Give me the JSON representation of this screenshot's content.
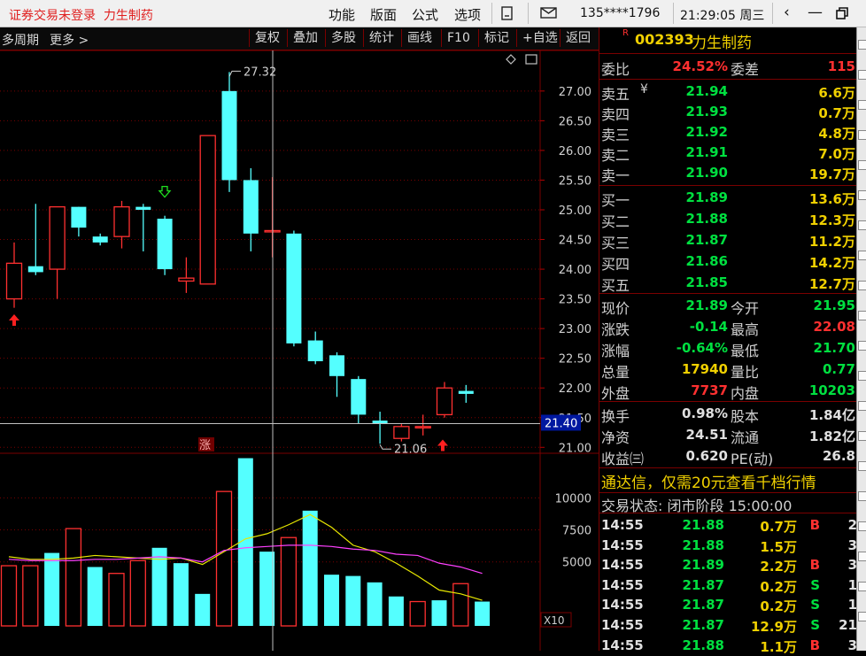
{
  "titlebar": {
    "status": "证券交易未登录",
    "stock_name": "力生制药",
    "menu": [
      "功能",
      "版面",
      "公式",
      "选项"
    ],
    "phone": "135****1796",
    "clock": "21:29:05 周三"
  },
  "toolbar": {
    "left": [
      "多周期",
      "更多 >"
    ],
    "buttons": [
      "复权",
      "叠加",
      "多股",
      "统计",
      "画线",
      "F10",
      "标记",
      "+自选",
      "返回"
    ]
  },
  "chart_data": {
    "type": "candlestick",
    "price_axis": {
      "ticks": [
        "27.00",
        "26.50",
        "26.00",
        "25.50",
        "25.00",
        "24.50",
        "24.00",
        "23.50",
        "23.00",
        "22.50",
        "22.00",
        "21.50",
        "21.00"
      ],
      "range": [
        20.9,
        27.4
      ]
    },
    "high_label": "27.32",
    "low_label": "21.06",
    "crosshair_price": "21.40",
    "zhang_label": "涨",
    "candles": [
      {
        "o": 23.5,
        "h": 24.45,
        "l": 23.35,
        "c": 24.1
      },
      {
        "o": 24.05,
        "h": 25.1,
        "l": 23.9,
        "c": 23.95
      },
      {
        "o": 24.0,
        "h": 25.05,
        "l": 23.5,
        "c": 25.05
      },
      {
        "o": 25.05,
        "h": 25.05,
        "l": 24.55,
        "c": 24.7
      },
      {
        "o": 24.55,
        "h": 24.6,
        "l": 24.4,
        "c": 24.45
      },
      {
        "o": 24.55,
        "h": 25.15,
        "l": 24.35,
        "c": 25.05
      },
      {
        "o": 25.05,
        "h": 25.1,
        "l": 24.3,
        "c": 25.0
      },
      {
        "o": 24.85,
        "h": 24.9,
        "l": 23.9,
        "c": 24.0
      },
      {
        "o": 23.8,
        "h": 24.2,
        "l": 23.6,
        "c": 23.85
      },
      {
        "o": 23.75,
        "h": 26.25,
        "l": 23.75,
        "c": 26.25
      },
      {
        "o": 27.0,
        "h": 27.32,
        "l": 25.3,
        "c": 25.5
      },
      {
        "o": 25.5,
        "h": 25.7,
        "l": 24.3,
        "c": 24.6
      },
      {
        "o": 24.65,
        "h": 25.55,
        "l": 24.2,
        "c": 24.65
      },
      {
        "o": 24.6,
        "h": 24.65,
        "l": 22.7,
        "c": 22.75
      },
      {
        "o": 22.8,
        "h": 22.95,
        "l": 22.4,
        "c": 22.45
      },
      {
        "o": 22.55,
        "h": 22.6,
        "l": 21.85,
        "c": 22.2
      },
      {
        "o": 22.15,
        "h": 22.2,
        "l": 21.4,
        "c": 21.55
      },
      {
        "o": 21.45,
        "h": 21.6,
        "l": 21.06,
        "c": 21.4
      },
      {
        "o": 21.15,
        "h": 21.4,
        "l": 21.1,
        "c": 21.35
      },
      {
        "o": 21.35,
        "h": 21.55,
        "l": 21.2,
        "c": 21.35
      },
      {
        "o": 21.55,
        "h": 22.1,
        "l": 21.5,
        "c": 22.0
      },
      {
        "o": 21.95,
        "h": 22.05,
        "l": 21.75,
        "c": 21.9
      }
    ],
    "volume_axis": {
      "ticks": [
        "10000",
        "7500",
        "5000"
      ],
      "range": [
        0,
        13000
      ]
    },
    "volume_unit": "X10",
    "volumes": [
      4700,
      4700,
      5700,
      7600,
      4600,
      4100,
      5100,
      6100,
      4900,
      2500,
      10500,
      13100,
      5800,
      6900,
      9000,
      4000,
      3900,
      3400,
      2300,
      1900,
      2000,
      3300,
      1900
    ],
    "volume_up": [
      true,
      true,
      false,
      true,
      false,
      true,
      true,
      false,
      false,
      false,
      true,
      false,
      false,
      true,
      false,
      false,
      false,
      false,
      false,
      true,
      false,
      true,
      false
    ],
    "ma5": [
      5400,
      5200,
      5200,
      5300,
      5500,
      5400,
      5300,
      5200,
      5300,
      4800,
      5800,
      6800,
      7200,
      7900,
      8700,
      7700,
      6300,
      5800,
      4900,
      3900,
      2800,
      2500,
      2000
    ],
    "ma10": [
      5200,
      5100,
      5100,
      5100,
      5200,
      5200,
      5300,
      5400,
      5300,
      5000,
      5900,
      6100,
      6200,
      6300,
      6300,
      6200,
      6000,
      5900,
      5600,
      5500,
      4900,
      4600,
      4100
    ]
  },
  "quote": {
    "code": "002393",
    "name": "力生制药",
    "weibi_label": "委比",
    "weibi": "24.52%",
    "weicha_label": "委差",
    "weicha": "115",
    "sell": [
      {
        "label": "卖五",
        "price": "21.94",
        "vol": "6.6万"
      },
      {
        "label": "卖四",
        "price": "21.93",
        "vol": "0.7万"
      },
      {
        "label": "卖三",
        "price": "21.92",
        "vol": "4.8万"
      },
      {
        "label": "卖二",
        "price": "21.91",
        "vol": "7.0万"
      },
      {
        "label": "卖一",
        "price": "21.90",
        "vol": "19.7万"
      }
    ],
    "buy": [
      {
        "label": "买一",
        "price": "21.89",
        "vol": "13.6万"
      },
      {
        "label": "买二",
        "price": "21.88",
        "vol": "12.3万"
      },
      {
        "label": "买三",
        "price": "21.87",
        "vol": "11.2万"
      },
      {
        "label": "买四",
        "price": "21.86",
        "vol": "14.2万"
      },
      {
        "label": "买五",
        "price": "21.85",
        "vol": "12.7万"
      }
    ],
    "stats": [
      {
        "l1": "现价",
        "v1": "21.89",
        "c1": "green",
        "l2": "今开",
        "v2": "21.95",
        "c2": "green"
      },
      {
        "l1": "涨跌",
        "v1": "-0.14",
        "c1": "green",
        "l2": "最高",
        "v2": "22.08",
        "c2": "red"
      },
      {
        "l1": "涨幅",
        "v1": "-0.64%",
        "c1": "green",
        "l2": "最低",
        "v2": "21.70",
        "c2": "green"
      },
      {
        "l1": "总量",
        "v1": "17940",
        "c1": "yellow",
        "l2": "量比",
        "v2": "0.77",
        "c2": "green"
      },
      {
        "l1": "外盘",
        "v1": "7737",
        "c1": "red",
        "l2": "内盘",
        "v2": "10203",
        "c2": "green"
      }
    ],
    "stats2": [
      {
        "l1": "换手",
        "v1": "0.98%",
        "l2": "股本",
        "v2": "1.84亿"
      },
      {
        "l1": "净资",
        "v1": "24.51",
        "l2": "流通",
        "v2": "1.82亿"
      },
      {
        "l1": "收益㈢",
        "v1": "0.620",
        "l2": "PE(动)",
        "v2": "26.8"
      }
    ],
    "ad": "通达信，仅需20元查看千档行情",
    "trade_status": "交易状态: 闭市阶段 15:00:00",
    "ticks": [
      {
        "t": "14:55",
        "p": "21.88",
        "v": "0.7万",
        "s": "B",
        "n": "2"
      },
      {
        "t": "14:55",
        "p": "21.88",
        "v": "1.5万",
        "s": "",
        "n": "3"
      },
      {
        "t": "14:55",
        "p": "21.89",
        "v": "2.2万",
        "s": "B",
        "n": "3"
      },
      {
        "t": "14:55",
        "p": "21.87",
        "v": "0.2万",
        "s": "S",
        "n": "1"
      },
      {
        "t": "14:55",
        "p": "21.87",
        "v": "0.2万",
        "s": "S",
        "n": "1"
      },
      {
        "t": "14:55",
        "p": "21.87",
        "v": "12.9万",
        "s": "S",
        "n": "21"
      },
      {
        "t": "14:55",
        "p": "21.88",
        "v": "1.1万",
        "s": "B",
        "n": "3"
      }
    ]
  }
}
